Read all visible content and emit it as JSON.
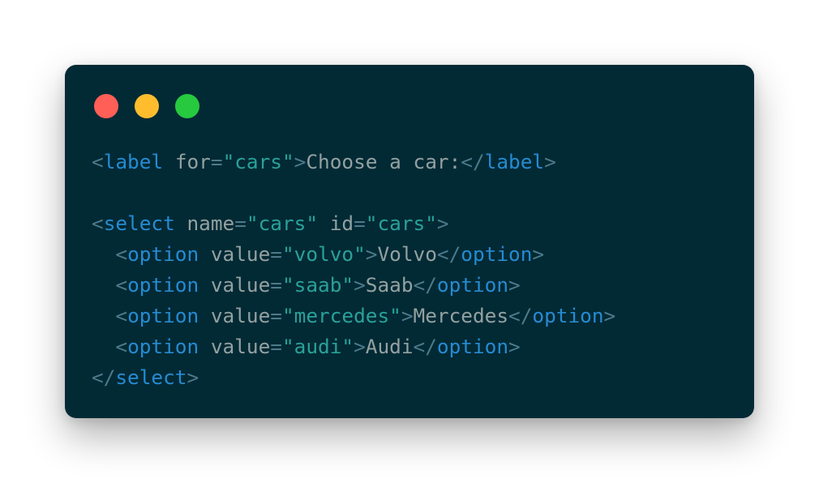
{
  "window": {
    "controls": [
      {
        "name": "close",
        "color": "#ff5f56"
      },
      {
        "name": "minimize",
        "color": "#ffbd2e"
      },
      {
        "name": "maximize",
        "color": "#27c93f"
      }
    ]
  },
  "code": {
    "language": "html",
    "lines": [
      [
        {
          "t": "punct",
          "v": "<"
        },
        {
          "t": "tag",
          "v": "label"
        },
        {
          "t": "ws",
          "v": " "
        },
        {
          "t": "attr",
          "v": "for"
        },
        {
          "t": "punct",
          "v": "="
        },
        {
          "t": "str",
          "v": "\"cars\""
        },
        {
          "t": "punct",
          "v": ">"
        },
        {
          "t": "text",
          "v": "Choose a car:"
        },
        {
          "t": "punct",
          "v": "</"
        },
        {
          "t": "tag",
          "v": "label"
        },
        {
          "t": "punct",
          "v": ">"
        }
      ],
      [],
      [
        {
          "t": "punct",
          "v": "<"
        },
        {
          "t": "tag",
          "v": "select"
        },
        {
          "t": "ws",
          "v": " "
        },
        {
          "t": "attr",
          "v": "name"
        },
        {
          "t": "punct",
          "v": "="
        },
        {
          "t": "str",
          "v": "\"cars\""
        },
        {
          "t": "ws",
          "v": " "
        },
        {
          "t": "attr",
          "v": "id"
        },
        {
          "t": "punct",
          "v": "="
        },
        {
          "t": "str",
          "v": "\"cars\""
        },
        {
          "t": "punct",
          "v": ">"
        }
      ],
      [
        {
          "t": "ws",
          "v": "  "
        },
        {
          "t": "punct",
          "v": "<"
        },
        {
          "t": "tag",
          "v": "option"
        },
        {
          "t": "ws",
          "v": " "
        },
        {
          "t": "attr",
          "v": "value"
        },
        {
          "t": "punct",
          "v": "="
        },
        {
          "t": "str",
          "v": "\"volvo\""
        },
        {
          "t": "punct",
          "v": ">"
        },
        {
          "t": "text",
          "v": "Volvo"
        },
        {
          "t": "punct",
          "v": "</"
        },
        {
          "t": "tag",
          "v": "option"
        },
        {
          "t": "punct",
          "v": ">"
        }
      ],
      [
        {
          "t": "ws",
          "v": "  "
        },
        {
          "t": "punct",
          "v": "<"
        },
        {
          "t": "tag",
          "v": "option"
        },
        {
          "t": "ws",
          "v": " "
        },
        {
          "t": "attr",
          "v": "value"
        },
        {
          "t": "punct",
          "v": "="
        },
        {
          "t": "str",
          "v": "\"saab\""
        },
        {
          "t": "punct",
          "v": ">"
        },
        {
          "t": "text",
          "v": "Saab"
        },
        {
          "t": "punct",
          "v": "</"
        },
        {
          "t": "tag",
          "v": "option"
        },
        {
          "t": "punct",
          "v": ">"
        }
      ],
      [
        {
          "t": "ws",
          "v": "  "
        },
        {
          "t": "punct",
          "v": "<"
        },
        {
          "t": "tag",
          "v": "option"
        },
        {
          "t": "ws",
          "v": " "
        },
        {
          "t": "attr",
          "v": "value"
        },
        {
          "t": "punct",
          "v": "="
        },
        {
          "t": "str",
          "v": "\"mercedes\""
        },
        {
          "t": "punct",
          "v": ">"
        },
        {
          "t": "text",
          "v": "Mercedes"
        },
        {
          "t": "punct",
          "v": "</"
        },
        {
          "t": "tag",
          "v": "option"
        },
        {
          "t": "punct",
          "v": ">"
        }
      ],
      [
        {
          "t": "ws",
          "v": "  "
        },
        {
          "t": "punct",
          "v": "<"
        },
        {
          "t": "tag",
          "v": "option"
        },
        {
          "t": "ws",
          "v": " "
        },
        {
          "t": "attr",
          "v": "value"
        },
        {
          "t": "punct",
          "v": "="
        },
        {
          "t": "str",
          "v": "\"audi\""
        },
        {
          "t": "punct",
          "v": ">"
        },
        {
          "t": "text",
          "v": "Audi"
        },
        {
          "t": "punct",
          "v": "</"
        },
        {
          "t": "tag",
          "v": "option"
        },
        {
          "t": "punct",
          "v": ">"
        }
      ],
      [
        {
          "t": "punct",
          "v": "</"
        },
        {
          "t": "tag",
          "v": "select"
        },
        {
          "t": "punct",
          "v": ">"
        }
      ]
    ]
  }
}
